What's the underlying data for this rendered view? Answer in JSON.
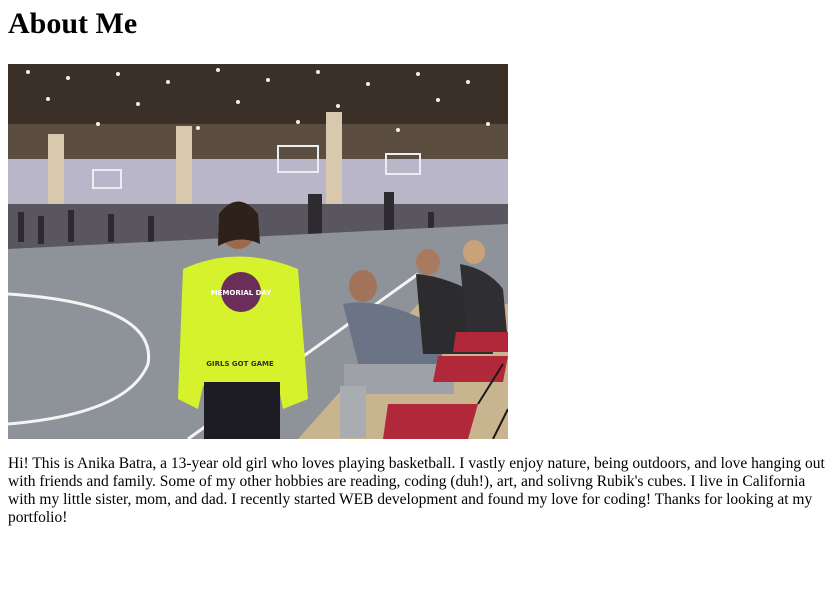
{
  "page": {
    "heading": "About Me",
    "photo": {
      "hoodie_text_top": "MEMORIAL DAY",
      "hoodie_text_bottom": "GIRLS GOT GAME"
    },
    "bio": "Hi! This is Anika Batra, a 13-year old girl who loves playing basketball. I vastly enjoy nature, being outdoors, and love hanging out with friends and family. Some of my other hobbies are reading, coding (duh!), art, and solivng Rubik's cubes. I live in California with my little sister, mom, and dad. I recently started WEB development and found my love for coding! Thanks for looking at my portfolio!"
  },
  "colors": {
    "court": "#8e9399",
    "hoodie": "#d6f22c",
    "chairs": "#b0283a"
  }
}
